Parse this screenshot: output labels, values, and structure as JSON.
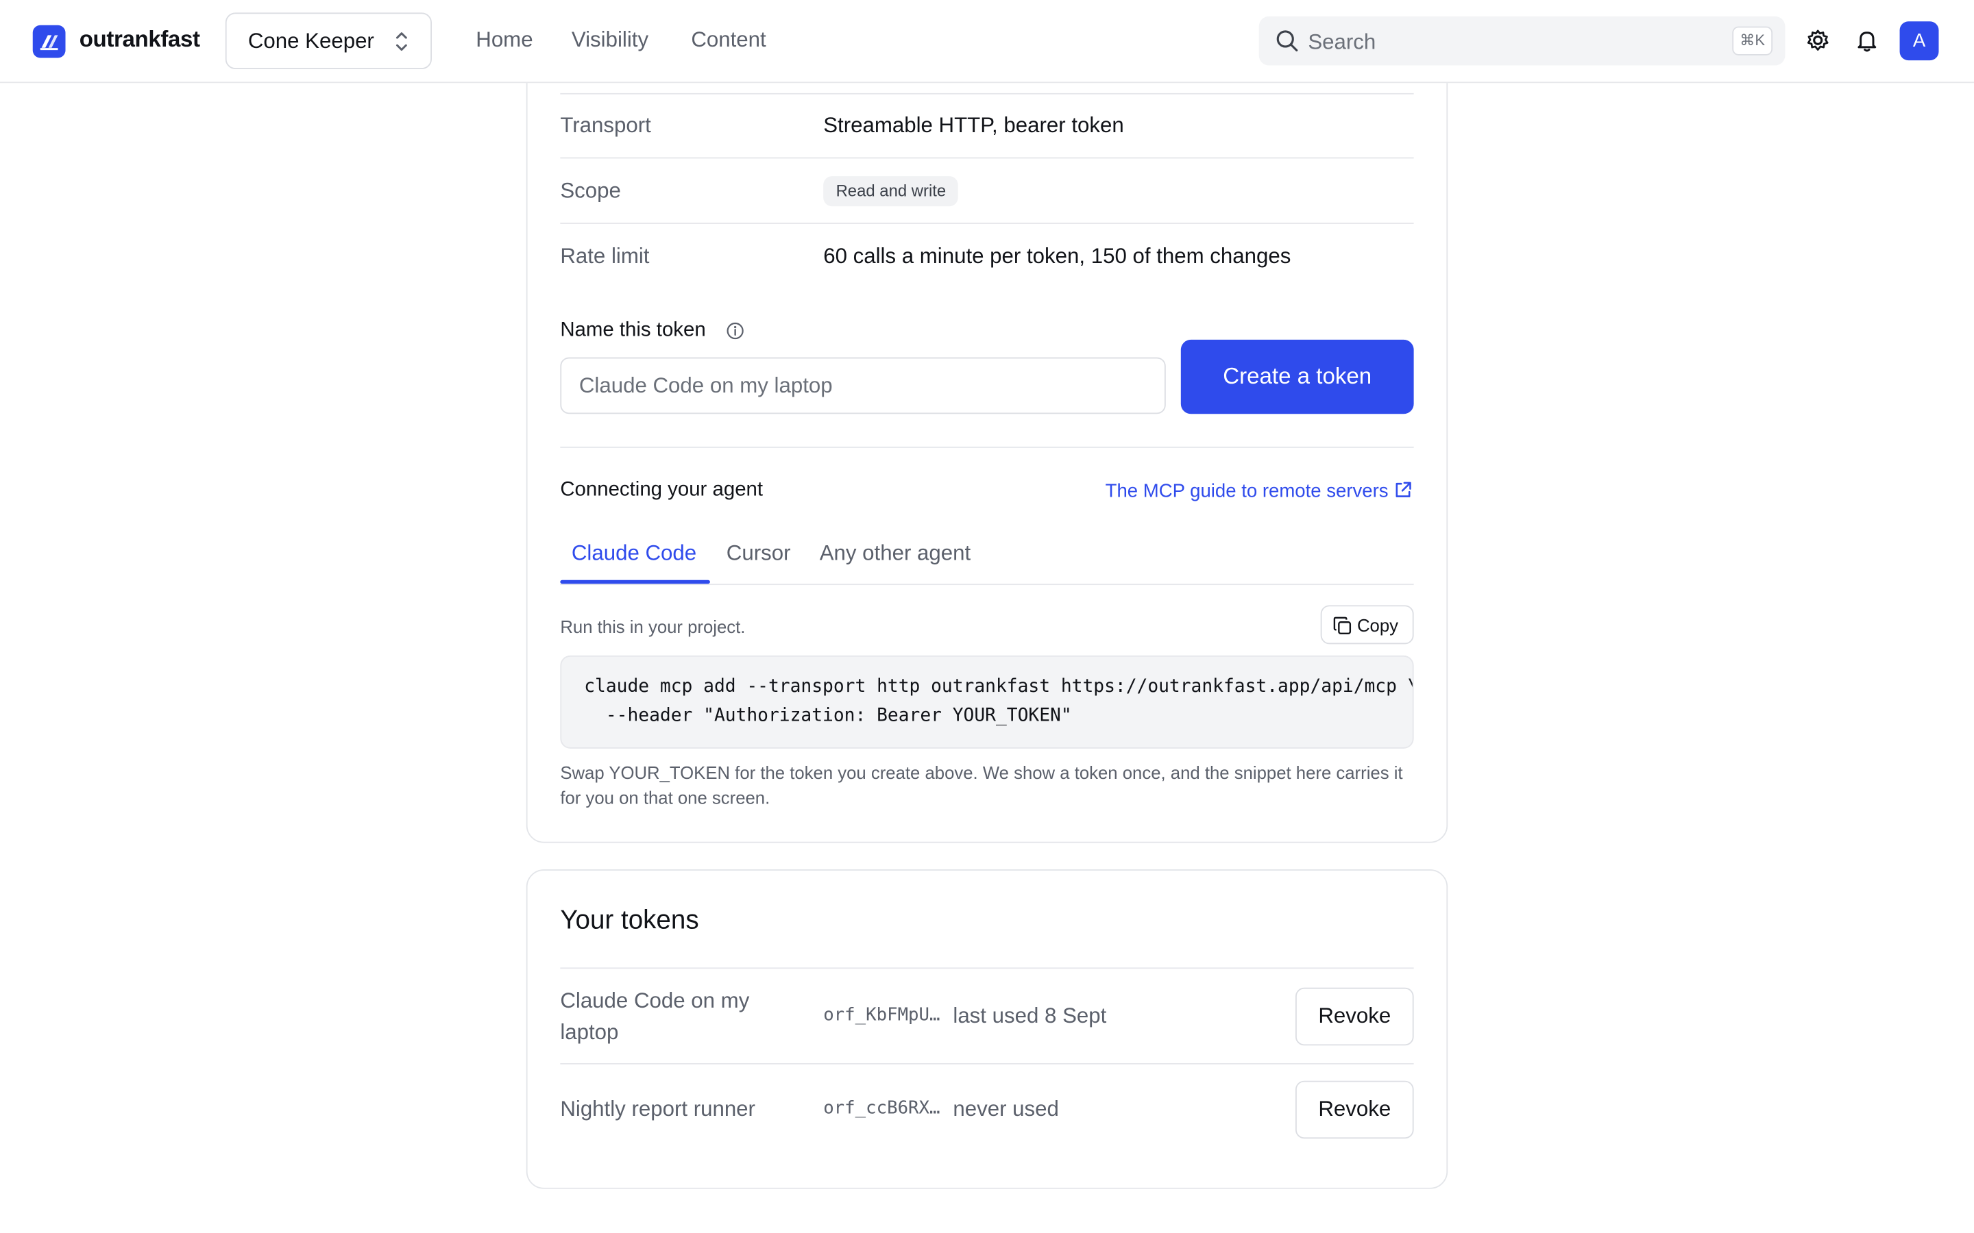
{
  "brand": {
    "name": "outrankfast",
    "logo_icon": "bolt-logo-icon",
    "accent": "#2f4bec"
  },
  "project": {
    "name": "Cone Keeper",
    "chevron_icon": "chevron-up-down-icon"
  },
  "nav": [
    {
      "label": "Home"
    },
    {
      "label": "Visibility"
    },
    {
      "label": "Content"
    }
  ],
  "search": {
    "placeholder": "Search",
    "shortcut": "⌘K",
    "icon": "search-icon"
  },
  "toolbar": {
    "settings_icon": "gear-icon",
    "notifications_icon": "bell-icon",
    "avatar_initial": "A"
  },
  "details": [
    {
      "label": "Transport",
      "value": "Streamable HTTP, bearer token"
    },
    {
      "label": "Scope",
      "value": "Read and write"
    },
    {
      "label": "Rate limit",
      "value": "60 calls a minute per token, 150 of them changes"
    }
  ],
  "create_token": {
    "label": "Name this token",
    "info_icon": "info-icon",
    "placeholder": "Claude Code on my laptop",
    "button": "Create a token"
  },
  "connect": {
    "title": "Connecting your agent",
    "guide_link": "The MCP guide to remote servers",
    "guide_icon": "external-link-icon",
    "tabs": [
      {
        "label": "Claude Code",
        "active": true
      },
      {
        "label": "Cursor",
        "active": false
      },
      {
        "label": "Any other agent",
        "active": false
      }
    ],
    "instruction": "Run this in your project.",
    "copy_label": "Copy",
    "copy_icon": "copy-icon",
    "code_lines": [
      "claude mcp add --transport http outrankfast https://outrankfast.app/api/mcp \\",
      "  --header \"Authorization: Bearer YOUR_TOKEN\""
    ],
    "note": "Swap YOUR_TOKEN for the token you create above. We show a token once, and the snippet here carries it for you on that one screen."
  },
  "tokens": {
    "title": "Your tokens",
    "items": [
      {
        "name": "Claude Code on my laptop",
        "id": "orf_KbFMpU…",
        "last_used": "last used 8 Sept",
        "action": "Revoke"
      },
      {
        "name": "Nightly report runner",
        "id": "orf_ccB6RX…",
        "last_used": "never used",
        "action": "Revoke"
      }
    ]
  }
}
